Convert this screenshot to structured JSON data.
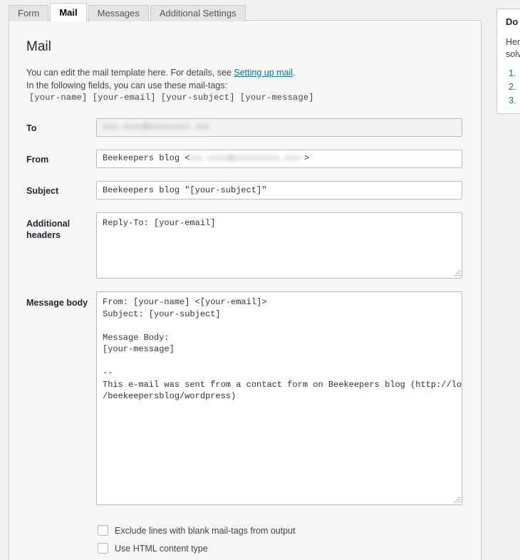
{
  "tabs": [
    {
      "label": "Form",
      "active": false
    },
    {
      "label": "Mail",
      "active": true
    },
    {
      "label": "Messages",
      "active": false
    },
    {
      "label": "Additional Settings",
      "active": false
    }
  ],
  "panel": {
    "title": "Mail",
    "intro_line1_before_link": "You can edit the mail template here. For details, see ",
    "intro_link": "Setting up mail",
    "intro_line1_after_link": ".",
    "intro_line2": "In the following fields, you can use these mail-tags:",
    "mail_tags": "[your-name] [your-email] [your-subject] [your-message]"
  },
  "fields": {
    "to": {
      "label": "To",
      "value_redacted": "xxx.xxxx@xxxxxxxx.xxx"
    },
    "from": {
      "label": "From",
      "prefix": "Beekeepers blog <",
      "value_redacted": "xxx.xxxx@xxxxxxxxx.xxx",
      "suffix": ">"
    },
    "subject": {
      "label": "Subject",
      "value": "Beekeepers blog \"[your-subject]\""
    },
    "additional_headers": {
      "label": "Additional headers",
      "value": "Reply-To: [your-email]"
    },
    "message_body": {
      "label": "Message body",
      "value": "From: [your-name] <[your-email]>\nSubject: [your-subject]\n\nMessage Body:\n[your-message]\n\n--\nThis e-mail was sent from a contact form on Beekeepers blog (http://localhost\n/beekeepersblog/wordpress)"
    }
  },
  "checkboxes": [
    {
      "label": "Exclude lines with blank mail-tags from output",
      "checked": false
    },
    {
      "label": "Use HTML content type",
      "checked": false
    }
  ],
  "sidebar": {
    "title": "Do y",
    "text_line1": "Here",
    "text_line2": "solve",
    "list": [
      "",
      "",
      ""
    ]
  },
  "colors": {
    "link": "#0073aa",
    "page_bg": "#f1f1f1",
    "panel_bg": "#f6f6f6"
  }
}
